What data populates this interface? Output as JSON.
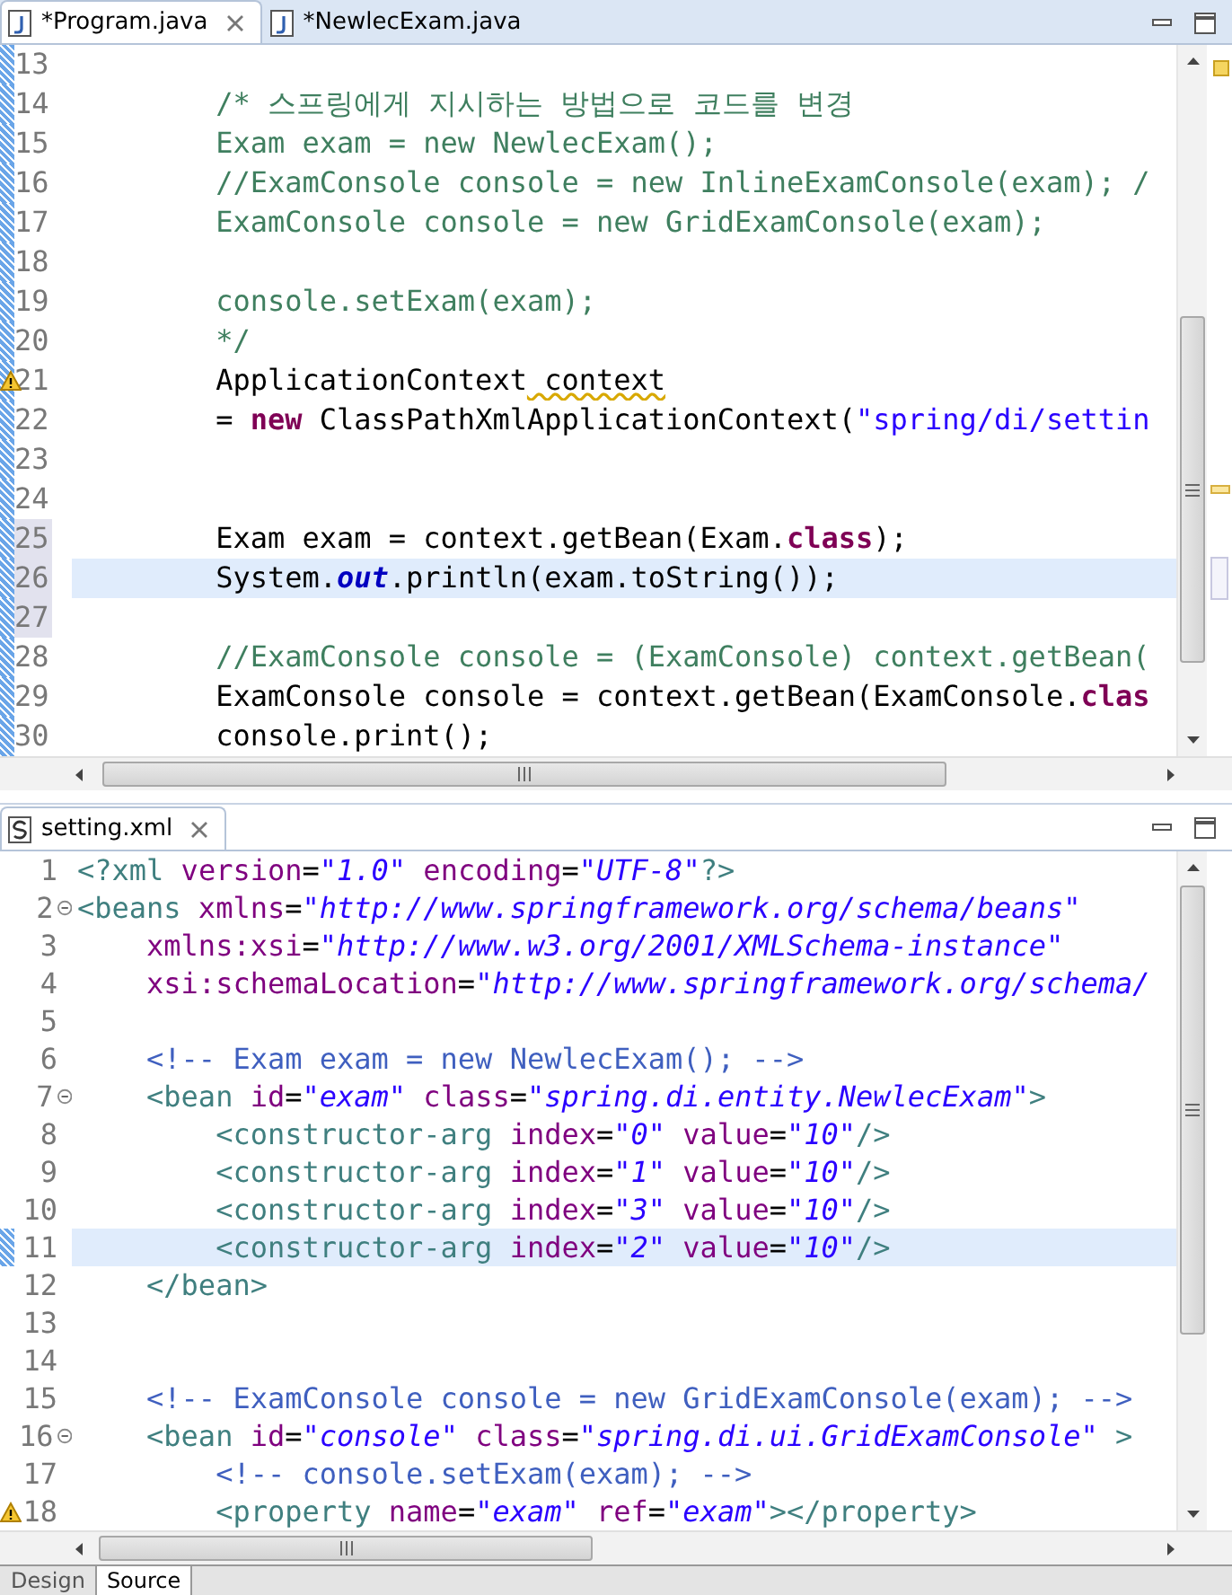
{
  "editors": [
    {
      "tabs": [
        {
          "label": "*Program.java",
          "selected": true,
          "closable": true
        },
        {
          "label": "*NewlecExam.java",
          "selected": false,
          "closable": false
        }
      ],
      "lines": [
        {
          "number": "13",
          "current": false,
          "changed": true,
          "in_range": false,
          "warning": false,
          "foldable": false
        },
        {
          "number": "14",
          "current": false,
          "changed": true,
          "in_range": false,
          "warning": false,
          "foldable": false,
          "segments": [
            {
              "kind": "comment",
              "text": "        /* 스프링에게 지시하는 방법으로 코드를 변경"
            }
          ]
        },
        {
          "number": "15",
          "current": false,
          "changed": true,
          "in_range": false,
          "warning": false,
          "foldable": false,
          "segments": [
            {
              "kind": "comment",
              "text": "        Exam exam = new NewlecExam();"
            }
          ]
        },
        {
          "number": "16",
          "current": false,
          "changed": true,
          "in_range": false,
          "warning": false,
          "foldable": false,
          "segments": [
            {
              "kind": "comment",
              "text": "        //ExamConsole console = new InlineExamConsole(exam); /"
            }
          ]
        },
        {
          "number": "17",
          "current": false,
          "changed": true,
          "in_range": false,
          "warning": false,
          "foldable": false,
          "segments": [
            {
              "kind": "comment",
              "text": "        ExamConsole console = new GridExamConsole(exam);"
            }
          ]
        },
        {
          "number": "18",
          "current": false,
          "changed": true,
          "in_range": false,
          "warning": false,
          "foldable": false
        },
        {
          "number": "19",
          "current": false,
          "changed": true,
          "in_range": false,
          "warning": false,
          "foldable": false,
          "segments": [
            {
              "kind": "comment",
              "text": "        console.setExam(exam);"
            }
          ]
        },
        {
          "number": "20",
          "current": false,
          "changed": true,
          "in_range": false,
          "warning": false,
          "foldable": false,
          "segments": [
            {
              "kind": "comment",
              "text": "        */"
            }
          ]
        },
        {
          "number": "21",
          "current": false,
          "changed": true,
          "in_range": false,
          "warning": true,
          "foldable": false,
          "segments": [
            {
              "kind": "plain",
              "text": "        ApplicationContext"
            },
            {
              "kind": "warning",
              "text": " context"
            }
          ]
        },
        {
          "number": "22",
          "current": false,
          "changed": true,
          "in_range": false,
          "warning": false,
          "foldable": false,
          "segments": [
            {
              "kind": "plain",
              "text": "        = "
            },
            {
              "kind": "keyword",
              "text": "new"
            },
            {
              "kind": "plain",
              "text": " ClassPathXmlApplicationContext("
            },
            {
              "kind": "string",
              "text": "\"spring/di/settin"
            }
          ]
        },
        {
          "number": "23",
          "current": false,
          "changed": true,
          "in_range": false,
          "warning": false,
          "foldable": false
        },
        {
          "number": "24",
          "current": false,
          "changed": true,
          "in_range": false,
          "warning": false,
          "foldable": false
        },
        {
          "number": "25",
          "current": false,
          "changed": true,
          "in_range": true,
          "warning": false,
          "foldable": false,
          "segments": [
            {
              "kind": "plain",
              "text": "        Exam exam = context.getBean(Exam."
            },
            {
              "kind": "keyword",
              "text": "class"
            },
            {
              "kind": "plain",
              "text": ");"
            }
          ]
        },
        {
          "number": "26",
          "current": true,
          "changed": true,
          "in_range": true,
          "warning": false,
          "foldable": false,
          "segments": [
            {
              "kind": "plain",
              "text": "        System."
            },
            {
              "kind": "field",
              "text": "out"
            },
            {
              "kind": "plain",
              "text": ".println(exam.toString());"
            }
          ]
        },
        {
          "number": "27",
          "current": false,
          "changed": true,
          "in_range": true,
          "warning": false,
          "foldable": false
        },
        {
          "number": "28",
          "current": false,
          "changed": true,
          "in_range": false,
          "warning": false,
          "foldable": false,
          "segments": [
            {
              "kind": "comment",
              "text": "        //ExamConsole console = (ExamConsole) context.getBean("
            }
          ]
        },
        {
          "number": "29",
          "current": false,
          "changed": true,
          "in_range": false,
          "warning": false,
          "foldable": false,
          "segments": [
            {
              "kind": "plain",
              "text": "        ExamConsole console = context.getBean(ExamConsole."
            },
            {
              "kind": "keyword",
              "text": "clas"
            }
          ]
        },
        {
          "number": "30",
          "current": false,
          "changed": true,
          "in_range": false,
          "warning": false,
          "foldable": false,
          "segments": [
            {
              "kind": "plain",
              "text": "        console.print();"
            }
          ]
        }
      ]
    },
    {
      "tabs": [
        {
          "label": "setting.xml",
          "selected": true,
          "closable": true
        }
      ],
      "lines": [
        {
          "number": "1",
          "current": false,
          "changed": false,
          "in_range": false,
          "warning": false,
          "foldable": false,
          "segments": [
            {
              "kind": "tag",
              "text": "<?xml"
            },
            {
              "kind": "attr",
              "text": " version"
            },
            {
              "kind": "plain",
              "text": "="
            },
            {
              "kind": "value",
              "text": "\"1.0\""
            },
            {
              "kind": "attr",
              "text": " encoding"
            },
            {
              "kind": "plain",
              "text": "="
            },
            {
              "kind": "value",
              "text": "\"UTF-8\""
            },
            {
              "kind": "tag",
              "text": "?>"
            }
          ]
        },
        {
          "number": "2",
          "current": false,
          "changed": false,
          "in_range": false,
          "warning": false,
          "foldable": true,
          "segments": [
            {
              "kind": "tag",
              "text": "<beans"
            },
            {
              "kind": "attr",
              "text": " xmlns"
            },
            {
              "kind": "plain",
              "text": "="
            },
            {
              "kind": "value",
              "text": "\"http://www.springframework.org/schema/beans\""
            }
          ]
        },
        {
          "number": "3",
          "current": false,
          "changed": false,
          "in_range": false,
          "warning": false,
          "foldable": false,
          "segments": [
            {
              "kind": "attr",
              "text": "    xmlns:xsi"
            },
            {
              "kind": "plain",
              "text": "="
            },
            {
              "kind": "value",
              "text": "\"http://www.w3.org/2001/XMLSchema-instance\""
            }
          ]
        },
        {
          "number": "4",
          "current": false,
          "changed": false,
          "in_range": false,
          "warning": false,
          "foldable": false,
          "segments": [
            {
              "kind": "attr",
              "text": "    xsi:schemaLocation"
            },
            {
              "kind": "plain",
              "text": "="
            },
            {
              "kind": "value",
              "text": "\"http://www.springframework.org/schema/"
            }
          ]
        },
        {
          "number": "5",
          "current": false,
          "changed": false,
          "in_range": false,
          "warning": false,
          "foldable": false
        },
        {
          "number": "6",
          "current": false,
          "changed": false,
          "in_range": false,
          "warning": false,
          "foldable": false,
          "segments": [
            {
              "kind": "comment",
              "text": "    <!-- Exam exam = new NewlecExam(); -->"
            }
          ]
        },
        {
          "number": "7",
          "current": false,
          "changed": false,
          "in_range": false,
          "warning": false,
          "foldable": true,
          "segments": [
            {
              "kind": "tag",
              "text": "    <bean"
            },
            {
              "kind": "attr",
              "text": " id"
            },
            {
              "kind": "plain",
              "text": "="
            },
            {
              "kind": "value",
              "text": "\"exam\""
            },
            {
              "kind": "attr",
              "text": " class"
            },
            {
              "kind": "plain",
              "text": "="
            },
            {
              "kind": "value",
              "text": "\"spring.di.entity.NewlecExam\""
            },
            {
              "kind": "tag",
              "text": ">"
            }
          ]
        },
        {
          "number": "8",
          "current": false,
          "changed": false,
          "in_range": false,
          "warning": false,
          "foldable": false,
          "segments": [
            {
              "kind": "tag",
              "text": "        <constructor-arg"
            },
            {
              "kind": "attr",
              "text": " index"
            },
            {
              "kind": "plain",
              "text": "="
            },
            {
              "kind": "value",
              "text": "\"0\""
            },
            {
              "kind": "attr",
              "text": " value"
            },
            {
              "kind": "plain",
              "text": "="
            },
            {
              "kind": "value",
              "text": "\"10\""
            },
            {
              "kind": "tag",
              "text": "/>"
            }
          ]
        },
        {
          "number": "9",
          "current": false,
          "changed": false,
          "in_range": false,
          "warning": false,
          "foldable": false,
          "segments": [
            {
              "kind": "tag",
              "text": "        <constructor-arg"
            },
            {
              "kind": "attr",
              "text": " index"
            },
            {
              "kind": "plain",
              "text": "="
            },
            {
              "kind": "value",
              "text": "\"1\""
            },
            {
              "kind": "attr",
              "text": " value"
            },
            {
              "kind": "plain",
              "text": "="
            },
            {
              "kind": "value",
              "text": "\"10\""
            },
            {
              "kind": "tag",
              "text": "/>"
            }
          ]
        },
        {
          "number": "10",
          "current": false,
          "changed": false,
          "in_range": false,
          "warning": false,
          "foldable": false,
          "segments": [
            {
              "kind": "tag",
              "text": "        <constructor-arg"
            },
            {
              "kind": "attr",
              "text": " index"
            },
            {
              "kind": "plain",
              "text": "="
            },
            {
              "kind": "value",
              "text": "\"3\""
            },
            {
              "kind": "attr",
              "text": " value"
            },
            {
              "kind": "plain",
              "text": "="
            },
            {
              "kind": "value",
              "text": "\"10\""
            },
            {
              "kind": "tag",
              "text": "/>"
            }
          ]
        },
        {
          "number": "11",
          "current": true,
          "changed": true,
          "in_range": false,
          "warning": false,
          "foldable": false,
          "segments": [
            {
              "kind": "tag",
              "text": "        <constructor-arg"
            },
            {
              "kind": "attr",
              "text": " index"
            },
            {
              "kind": "plain",
              "text": "="
            },
            {
              "kind": "value",
              "text": "\"2\""
            },
            {
              "kind": "attr",
              "text": " value"
            },
            {
              "kind": "plain",
              "text": "="
            },
            {
              "kind": "value",
              "text": "\"10\""
            },
            {
              "kind": "tag",
              "text": "/>"
            }
          ]
        },
        {
          "number": "12",
          "current": false,
          "changed": false,
          "in_range": false,
          "warning": false,
          "foldable": false,
          "segments": [
            {
              "kind": "tag",
              "text": "    </bean>"
            }
          ]
        },
        {
          "number": "13",
          "current": false,
          "changed": false,
          "in_range": false,
          "warning": false,
          "foldable": false
        },
        {
          "number": "14",
          "current": false,
          "changed": false,
          "in_range": false,
          "warning": false,
          "foldable": false
        },
        {
          "number": "15",
          "current": false,
          "changed": false,
          "in_range": false,
          "warning": false,
          "foldable": false,
          "segments": [
            {
              "kind": "comment",
              "text": "    <!-- ExamConsole console = new GridExamConsole(exam); -->"
            }
          ]
        },
        {
          "number": "16",
          "current": false,
          "changed": false,
          "in_range": false,
          "warning": false,
          "foldable": true,
          "segments": [
            {
              "kind": "tag",
              "text": "    <bean"
            },
            {
              "kind": "attr",
              "text": " id"
            },
            {
              "kind": "plain",
              "text": "="
            },
            {
              "kind": "value",
              "text": "\"console\""
            },
            {
              "kind": "attr",
              "text": " class"
            },
            {
              "kind": "plain",
              "text": "="
            },
            {
              "kind": "value",
              "text": "\"spring.di.ui.GridExamConsole\""
            },
            {
              "kind": "tag",
              "text": " >"
            }
          ]
        },
        {
          "number": "17",
          "current": false,
          "changed": false,
          "in_range": false,
          "warning": false,
          "foldable": false,
          "segments": [
            {
              "kind": "comment",
              "text": "        <!-- console.setExam(exam); -->"
            }
          ]
        },
        {
          "number": "18",
          "current": false,
          "changed": false,
          "in_range": false,
          "warning": true,
          "foldable": false,
          "segments": [
            {
              "kind": "tag",
              "text": "        <property"
            },
            {
              "kind": "attr",
              "text": " name"
            },
            {
              "kind": "plain",
              "text": "="
            },
            {
              "kind": "value",
              "text": "\"exam\""
            },
            {
              "kind": "attr",
              "text": " ref"
            },
            {
              "kind": "plain",
              "text": "="
            },
            {
              "kind": "value",
              "text": "\"exam\""
            },
            {
              "kind": "tag",
              "text": "></property>"
            }
          ]
        }
      ],
      "bottom_tabs": [
        {
          "label": "Design",
          "selected": false
        },
        {
          "label": "Source",
          "selected": true
        }
      ]
    }
  ]
}
